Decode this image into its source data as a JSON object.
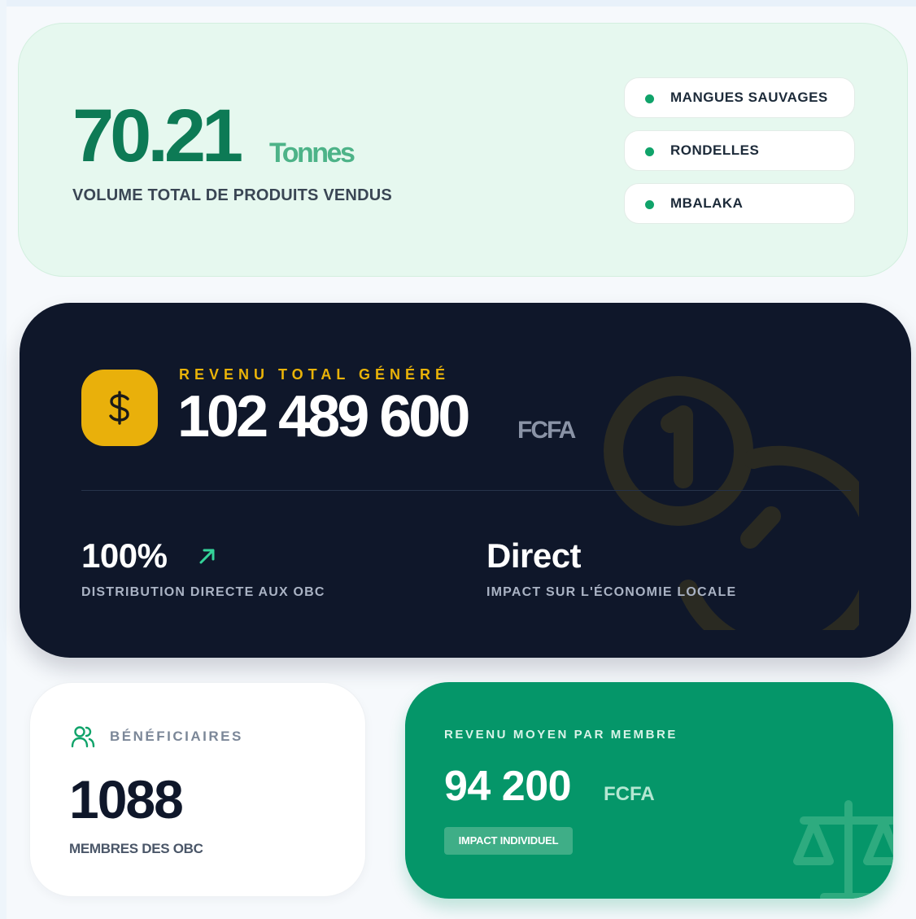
{
  "volume": {
    "value": "70.21",
    "unit": "Tonnes",
    "label": "VOLUME TOTAL DE PRODUITS VENDUS",
    "products": [
      "MANGUES SAUVAGES",
      "RONDELLES",
      "MBALAKA"
    ]
  },
  "revenue": {
    "label": "REVENU TOTAL GÉNÉRÉ",
    "value": "102 489 600",
    "unit": "FCFA",
    "icon": "dollar-icon",
    "stats": [
      {
        "value": "100%",
        "label": "DISTRIBUTION DIRECTE AUX OBC",
        "icon": "arrow-up-right-icon"
      },
      {
        "value": "Direct",
        "label": "IMPACT SUR L'ÉCONOMIE LOCALE"
      }
    ]
  },
  "beneficiaries": {
    "title": "BÉNÉFICIAIRES",
    "value": "1088",
    "label": "MEMBRES DES OBC",
    "icon": "users-icon"
  },
  "average": {
    "title": "REVENU MOYEN PAR MEMBRE",
    "value": "94 200",
    "unit": "FCFA",
    "badge": "IMPACT INDIVIDUEL",
    "icon": "scale-icon"
  },
  "colors": {
    "green_dark": "#0d7a55",
    "green_accent": "#059669",
    "navy": "#0f172a",
    "gold": "#eab308",
    "mint_bg": "#e6f8ef"
  }
}
